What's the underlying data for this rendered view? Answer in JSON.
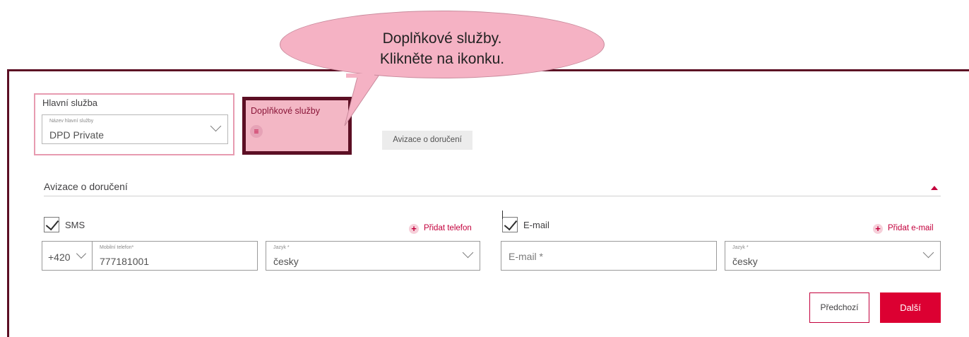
{
  "callout": {
    "line1": "Doplňkové služby.",
    "line2": "Klikněte na ikonku."
  },
  "main_service": {
    "title": "Hlavní služba",
    "field_label": "Název hlavní služby",
    "value": "DPD Private"
  },
  "additional_services": {
    "title": "Doplňkové služby",
    "icon": "menu-icon"
  },
  "tabs": [
    {
      "label": "Avizace o doručení"
    }
  ],
  "notification": {
    "section_title": "Avizace o doručení",
    "sms": {
      "label": "SMS",
      "checked": true,
      "add_label": "Přidat telefon",
      "prefix": "+420",
      "phone_label": "Mobilní telefon*",
      "phone_value": "777181001",
      "lang_label": "Jazyk *",
      "lang_value": "česky"
    },
    "email": {
      "label": "E-mail",
      "checked": true,
      "add_label": "Přidat e-mail",
      "email_placeholder": "E-mail *",
      "lang_label": "Jazyk *",
      "lang_value": "česky"
    }
  },
  "buttons": {
    "prev": "Předchozí",
    "next": "Další"
  },
  "colors": {
    "brand": "#dc0032",
    "frame": "#5c0f24",
    "highlight": "#f3b7c5"
  }
}
